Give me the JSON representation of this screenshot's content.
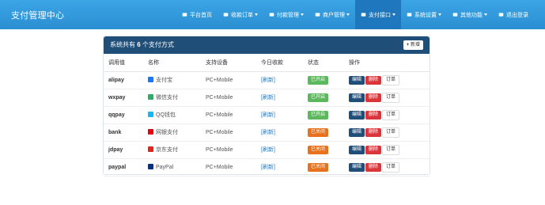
{
  "brand": "支付管理中心",
  "nav": [
    {
      "label": "平台首页",
      "icon": "home-icon",
      "caret": false,
      "active": false
    },
    {
      "label": "收款订单",
      "icon": "list-icon",
      "caret": true,
      "active": false
    },
    {
      "label": "付款管理",
      "icon": "cloud-icon",
      "caret": true,
      "active": false
    },
    {
      "label": "商户管理",
      "icon": "user-icon",
      "caret": true,
      "active": false
    },
    {
      "label": "支付接口",
      "icon": "card-icon",
      "caret": true,
      "active": true
    },
    {
      "label": "系统设置",
      "icon": "gear-icon",
      "caret": true,
      "active": false
    },
    {
      "label": "其他功能",
      "icon": "globe-icon",
      "caret": true,
      "active": false
    },
    {
      "label": "退出登录",
      "icon": "power-icon",
      "caret": false,
      "active": false
    }
  ],
  "panel": {
    "title_prefix": "系统共有",
    "count": "6",
    "title_suffix": "个支付方式",
    "add_label": "新增"
  },
  "table": {
    "headers": [
      "调用值",
      "名称",
      "支持设备",
      "今日收款",
      "状态",
      "操作"
    ],
    "rows": [
      {
        "code": "alipay",
        "name": "支付宝",
        "icon": "alipay-icon",
        "icon_color": "#1677ff",
        "device": "PC+Mobile",
        "today": "[刷新]",
        "status": "已开启",
        "enabled": true
      },
      {
        "code": "wxpay",
        "name": "微信支付",
        "icon": "wechat-icon",
        "icon_color": "#2aae67",
        "device": "PC+Mobile",
        "today": "[刷新]",
        "status": "已开启",
        "enabled": true
      },
      {
        "code": "qqpay",
        "name": "QQ钱包",
        "icon": "qq-icon",
        "icon_color": "#12b7f5",
        "device": "PC+Mobile",
        "today": "[刷新]",
        "status": "已开启",
        "enabled": true
      },
      {
        "code": "bank",
        "name": "网银支付",
        "icon": "unionpay-icon",
        "icon_color": "#e60012",
        "device": "PC+Mobile",
        "today": "[刷新]",
        "status": "已关闭",
        "enabled": false
      },
      {
        "code": "jdpay",
        "name": "京东支付",
        "icon": "jd-icon",
        "icon_color": "#e1251b",
        "device": "PC+Mobile",
        "today": "[刷新]",
        "status": "已关闭",
        "enabled": false
      },
      {
        "code": "paypal",
        "name": "PayPal",
        "icon": "paypal-icon",
        "icon_color": "#003087",
        "device": "PC+Mobile",
        "today": "[刷新]",
        "status": "已关闭",
        "enabled": false
      }
    ],
    "actions": {
      "edit": "编辑",
      "delete": "删除",
      "orders": "订单"
    }
  }
}
